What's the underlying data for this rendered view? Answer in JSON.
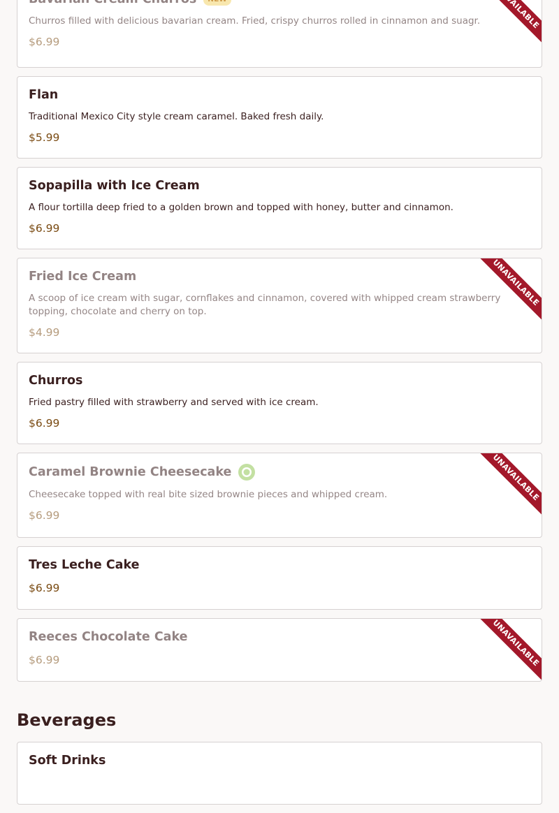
{
  "desserts": {
    "items": [
      {
        "name": "Bavarian Cream Churros",
        "badge": "NEW",
        "description": "Churros filled with delicious bavarian cream. Fried, crispy churros rolled in cinnamon and suagr.",
        "price": "$6.99",
        "status": "UNAVAILABLE"
      },
      {
        "name": "Flan",
        "description": "Traditional Mexico City style cream caramel. Baked fresh daily.",
        "price": "$5.99"
      },
      {
        "name": "Sopapilla with Ice Cream",
        "description": "A flour tortilla deep fried to a golden brown and topped with honey, butter and cinnamon.",
        "price": "$6.99"
      },
      {
        "name": "Fried Ice Cream",
        "description": "A scoop of ice cream with sugar, cornflakes and cinnamon, covered with whipped cream strawberry topping, chocolate and cherry on top.",
        "price": "$4.99",
        "status": "UNAVAILABLE"
      },
      {
        "name": "Churros",
        "description": "Fried pastry filled with strawberry and served with ice cream.",
        "price": "$6.99"
      },
      {
        "name": "Caramel Brownie Cheesecake",
        "icon": "vegetarian-icon",
        "description": "Cheesecake topped with real bite sized brownie pieces and whipped cream.",
        "price": "$6.99",
        "status": "UNAVAILABLE"
      },
      {
        "name": "Tres Leche Cake",
        "price": "$6.99"
      },
      {
        "name": "Reeces Chocolate Cake",
        "price": "$6.99",
        "status": "UNAVAILABLE"
      }
    ]
  },
  "beverages": {
    "section_title": "Beverages",
    "items": [
      {
        "name": "Soft Drinks"
      }
    ]
  },
  "colors": {
    "ribbon": "#a3182a",
    "price": "#7a4b13",
    "text": "#3a1f1f",
    "badge_new_bg": "#f7e3a0",
    "veg_icon": "#9ccc65"
  }
}
